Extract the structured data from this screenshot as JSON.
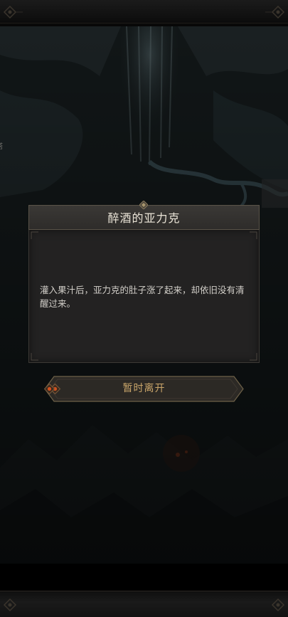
{
  "side_mark": "塔",
  "dialog": {
    "title": "醉酒的亚力克",
    "text": "灌入果汁后，亚力克的肚子涨了起来，却依旧没有清醒过来。"
  },
  "action": {
    "label": "暂时离开"
  },
  "colors": {
    "title_text": "#e9e3d6",
    "body_text": "#d2cfc9",
    "button_text": "#c9a56a",
    "panel_bg": "#232222",
    "accent_gem": "#d0501e"
  }
}
